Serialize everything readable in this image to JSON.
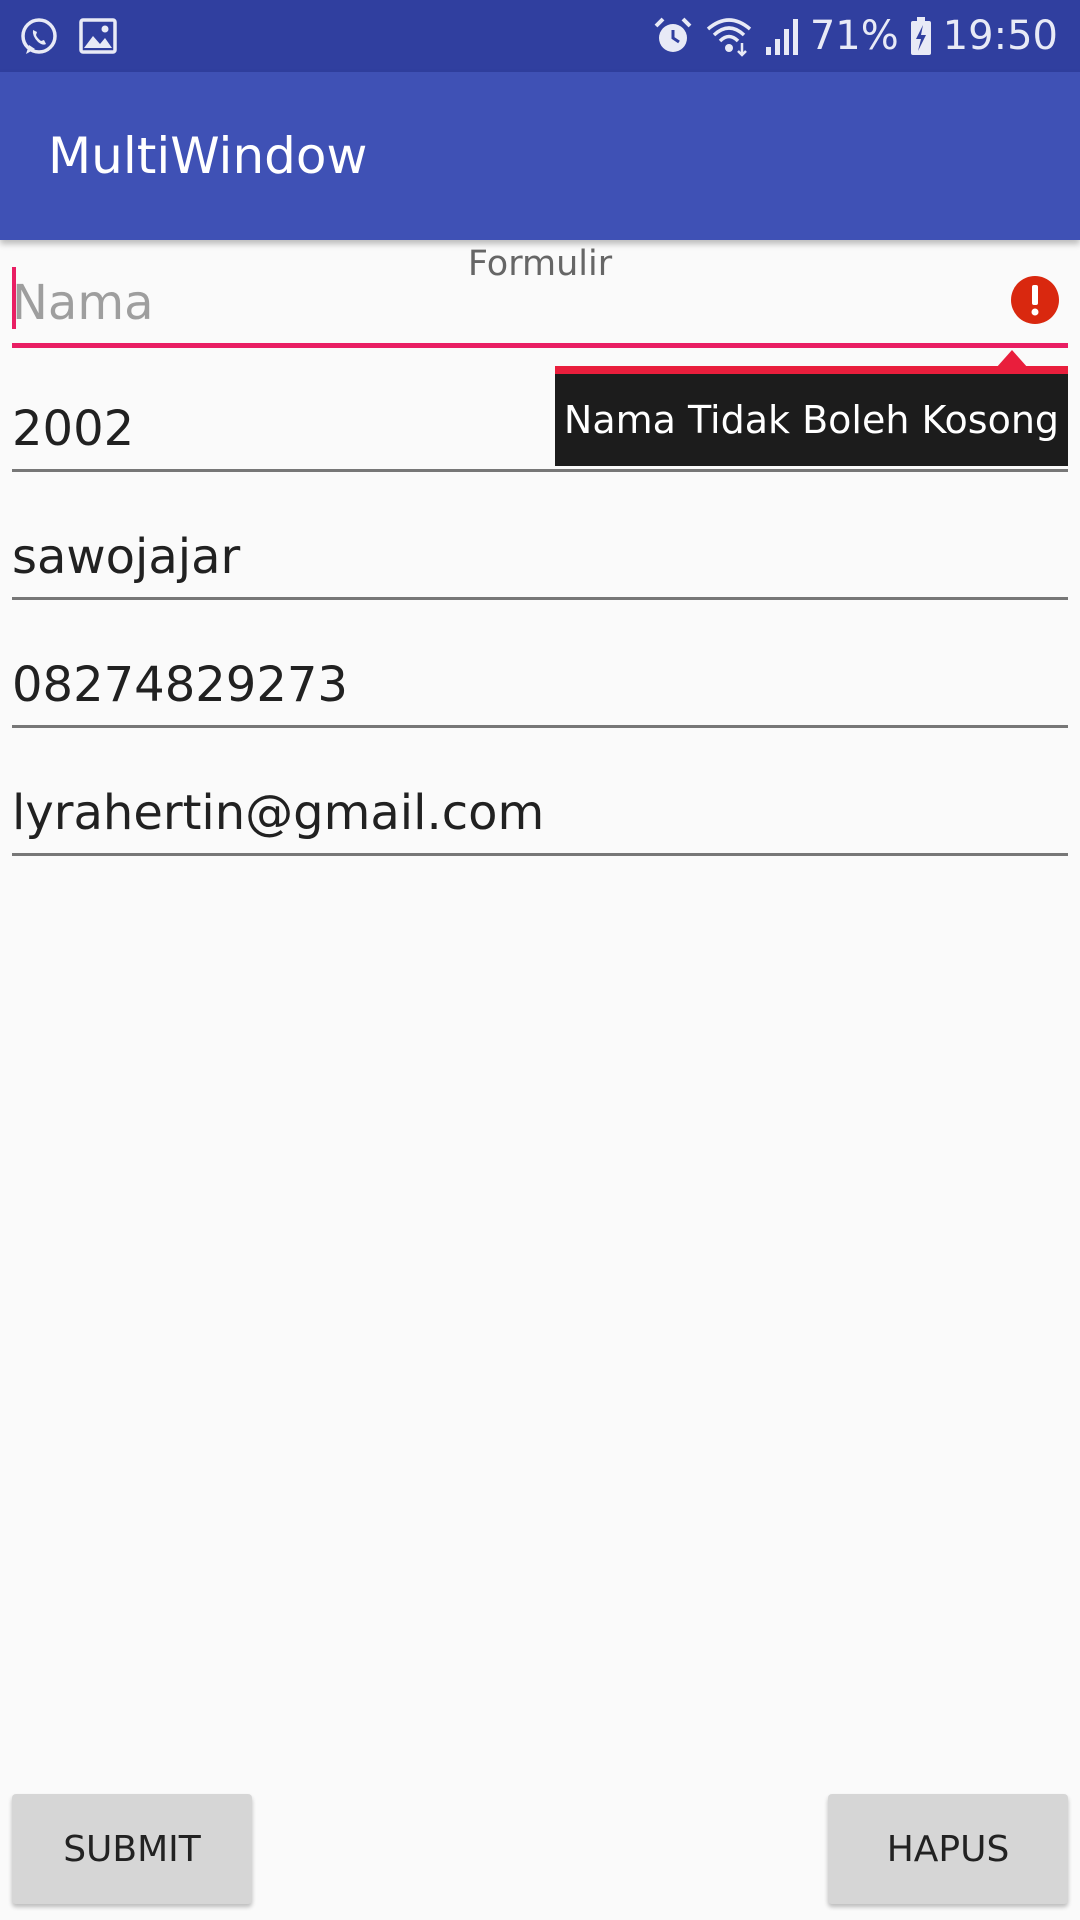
{
  "status_bar": {
    "icons_left": [
      "whatsapp-icon",
      "image-icon"
    ],
    "icons_right": [
      "alarm-icon",
      "wifi-icon",
      "signal-icon",
      "battery-charging-icon"
    ],
    "battery": "71%",
    "time": "19:50"
  },
  "app_bar": {
    "title": "MultiWindow"
  },
  "form": {
    "heading": "Formulir",
    "name_field": {
      "placeholder": "Nama",
      "value": "",
      "error": "Nama Tidak Boleh Kosong"
    },
    "year_field": {
      "value": "2002"
    },
    "address_field": {
      "value": "sawojajar"
    },
    "phone_field": {
      "value": "08274829273"
    },
    "email_field": {
      "value": "lyrahertin@gmail.com"
    }
  },
  "buttons": {
    "submit": "SUBMIT",
    "clear": "HAPUS"
  },
  "colors": {
    "status_bar": "#303f9f",
    "app_bar": "#3f51b5",
    "accent": "#e91e63",
    "error_icon": "#d9280f",
    "tooltip_bg": "#1c1c1c"
  }
}
